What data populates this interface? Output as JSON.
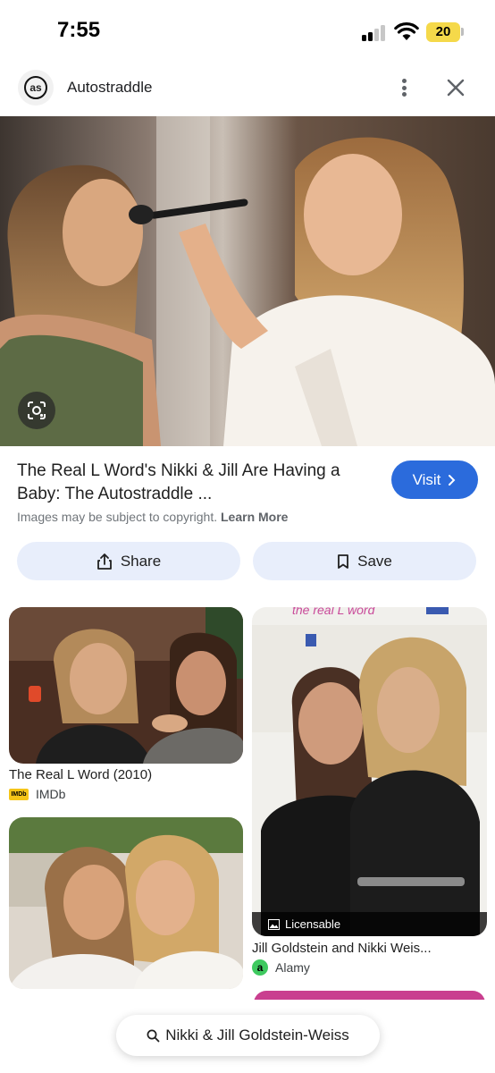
{
  "status_bar": {
    "time": "7:55",
    "battery": "20"
  },
  "header": {
    "site_name": "Autostraddle",
    "logo_text": "as"
  },
  "result": {
    "title": "The Real L Word's Nikki & Jill Are Having a Baby: The Autostraddle ...",
    "visit_label": "Visit",
    "copyright_text": "Images may be subject to copyright.",
    "learn_more": "Learn More",
    "share_label": "Share",
    "save_label": "Save"
  },
  "related": [
    {
      "title": "The Real L Word (2010)",
      "source": "IMDb",
      "source_badge": "IMDb"
    },
    {
      "title": "Jill Goldstein and Nikki Weis...",
      "source": "Alamy",
      "source_badge": "a",
      "overlay": "Licensable",
      "banner": "the real L word"
    }
  ],
  "search": {
    "query": "Nikki & Jill Goldstein-Weiss"
  },
  "colors": {
    "visit_blue": "#2b6bdc",
    "pill_bg": "#e8eefb",
    "battery": "#f5d94a"
  }
}
